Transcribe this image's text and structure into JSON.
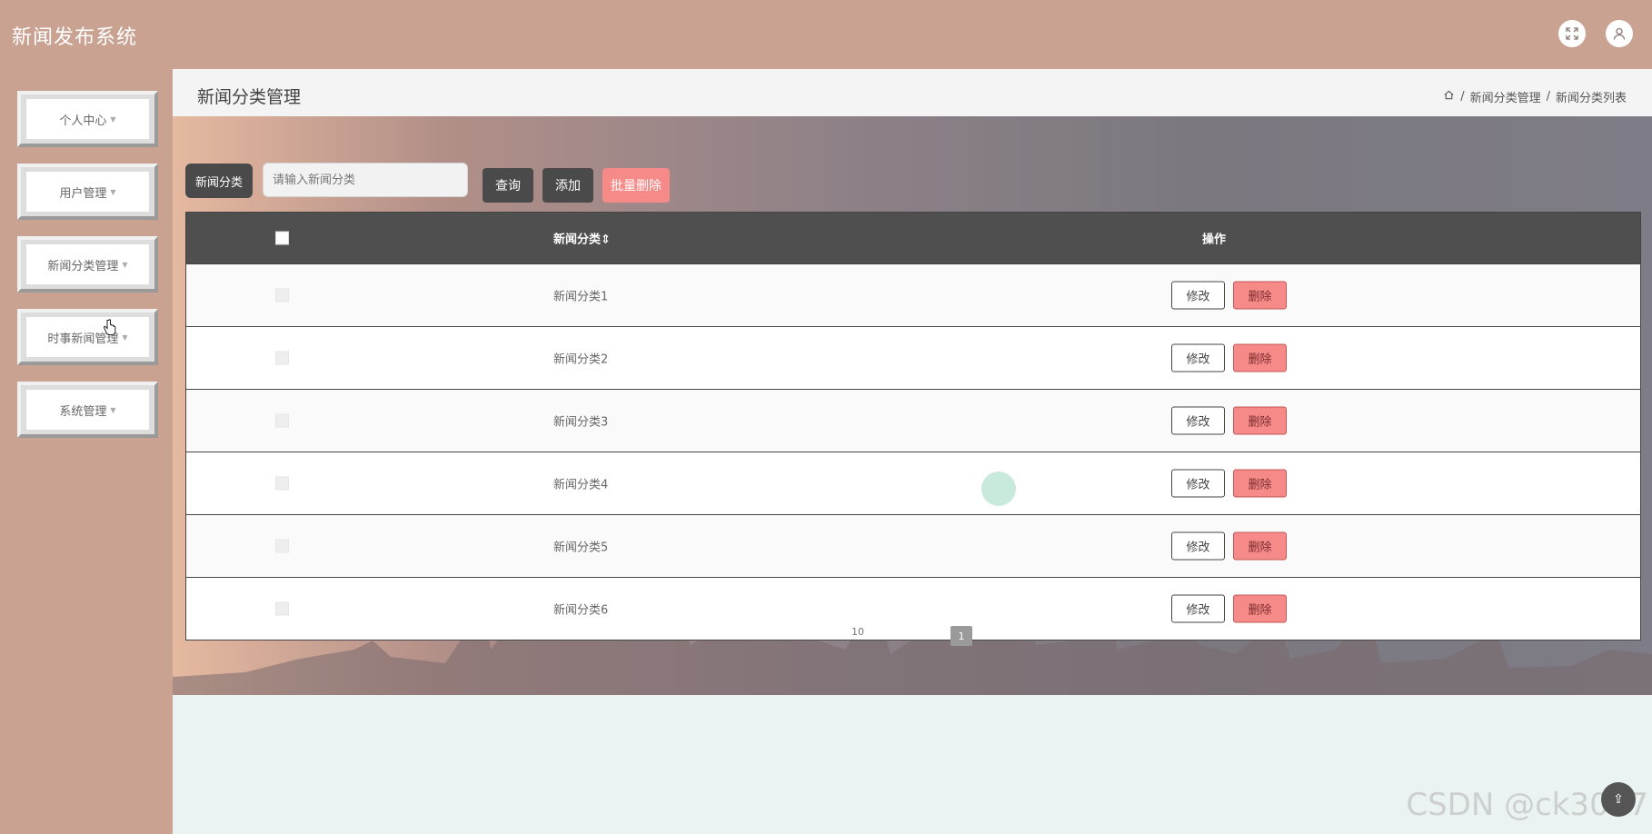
{
  "app": {
    "title": "新闻发布系统"
  },
  "header": {
    "icons": [
      "fullscreen-icon",
      "user-icon"
    ]
  },
  "sidebar": {
    "items": [
      {
        "label": "个人中心"
      },
      {
        "label": "用户管理"
      },
      {
        "label": "新闻分类管理"
      },
      {
        "label": "时事新闻管理"
      },
      {
        "label": "系统管理"
      }
    ]
  },
  "page": {
    "title": "新闻分类管理",
    "breadcrumb": [
      "新闻分类管理",
      "新闻分类列表"
    ]
  },
  "search": {
    "label": "新闻分类",
    "placeholder": "请输入新闻分类",
    "query_label": "查询",
    "add_label": "添加",
    "batch_delete_label": "批量删除"
  },
  "table": {
    "columns": {
      "name": "新闻分类",
      "sort_icon": "sort-icon",
      "actions": "操作"
    },
    "rows": [
      {
        "name": "新闻分类1",
        "edit": "修改",
        "delete": "删除"
      },
      {
        "name": "新闻分类2",
        "edit": "修改",
        "delete": "删除"
      },
      {
        "name": "新闻分类3",
        "edit": "修改",
        "delete": "删除"
      },
      {
        "name": "新闻分类4",
        "edit": "修改",
        "delete": "删除"
      },
      {
        "name": "新闻分类5",
        "edit": "修改",
        "delete": "删除"
      },
      {
        "name": "新闻分类6",
        "edit": "修改",
        "delete": "删除"
      }
    ]
  },
  "pagination": {
    "page_size": "10",
    "current_page": "1"
  },
  "watermark": "CSDN @ck3017",
  "colors": {
    "brand": "#c9a292",
    "dark_button": "#4a4a4a",
    "danger": "#f58a89",
    "table_header": "#4f4f4f"
  }
}
